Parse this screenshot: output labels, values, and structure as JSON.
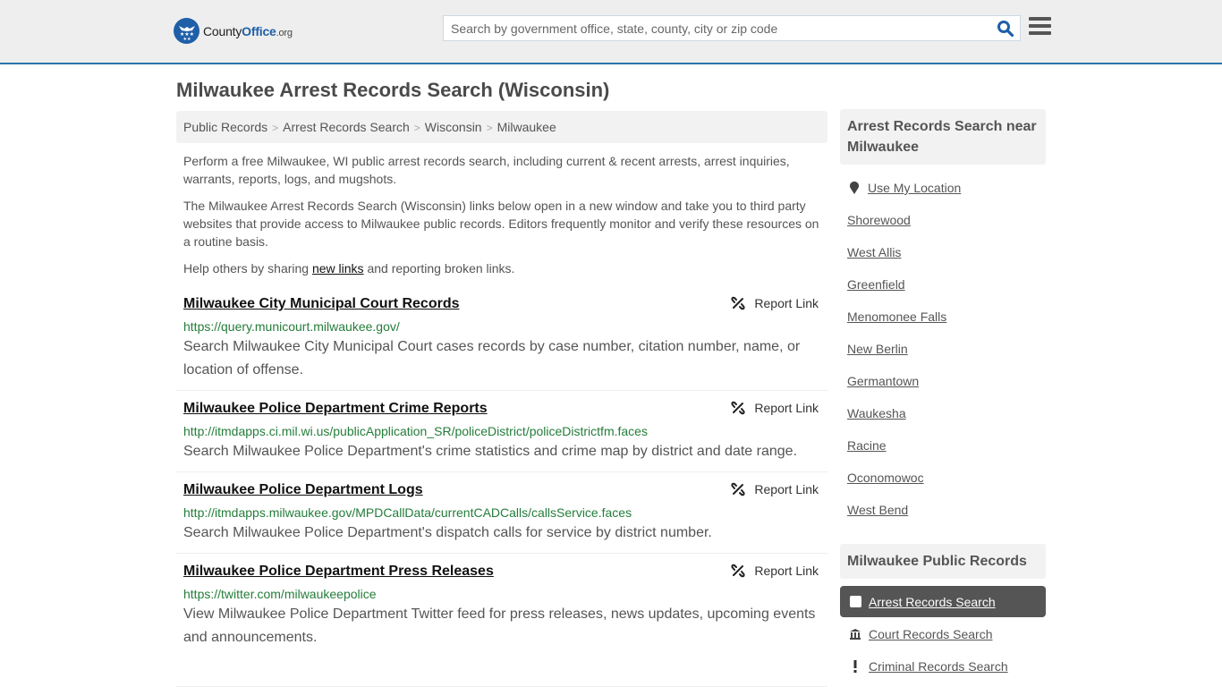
{
  "header": {
    "logo": {
      "name_part1": "County",
      "name_part2": "Office",
      "name_suffix": ".org"
    },
    "search": {
      "placeholder": "Search by government office, state, county, city or zip code",
      "value": ""
    },
    "colors": {
      "brand": "#1e5fa8",
      "header_bg": "#eeeeee",
      "accent_line": "#2b75ad"
    }
  },
  "page": {
    "title": "Milwaukee Arrest Records Search (Wisconsin)",
    "breadcrumb": [
      "Public Records",
      "Arrest Records Search",
      "Wisconsin",
      "Milwaukee"
    ],
    "breadcrumb_separator": ">",
    "intro": {
      "p1": "Perform a free Milwaukee, WI public arrest records search, including current & recent arrests, arrest inquiries, warrants, reports, logs, and mugshots.",
      "p2": "The Milwaukee Arrest Records Search (Wisconsin) links below open in a new window and take you to third party websites that provide access to Milwaukee public records. Editors frequently monitor and verify these resources on a routine basis.",
      "p3_before": "Help others by sharing ",
      "p3_link": "new links",
      "p3_after": " and reporting broken links."
    },
    "report_label": "Report Link",
    "listings": [
      {
        "title": "Milwaukee City Municipal Court Records",
        "url": "https://query.municourt.milwaukee.gov/",
        "description": "Search Milwaukee City Municipal Court cases records by case number, citation number, name, or location of offense."
      },
      {
        "title": "Milwaukee Police Department Crime Reports",
        "url": "http://itmdapps.ci.mil.wi.us/publicApplication_SR/policeDistrict/policeDistrictfm.faces",
        "description": "Search Milwaukee Police Department's crime statistics and crime map by district and date range."
      },
      {
        "title": "Milwaukee Police Department Logs",
        "url": "http://itmdapps.milwaukee.gov/MPDCallData/currentCADCalls/callsService.faces",
        "description": "Search Milwaukee Police Department's dispatch calls for service by district number."
      },
      {
        "title": "Milwaukee Police Department Press Releases",
        "url": "https://twitter.com/milwaukeepolice",
        "description": "View Milwaukee Police Department Twitter feed for press releases, news updates, upcoming events and announcements."
      }
    ]
  },
  "sidebar": {
    "nearby_heading": "Arrest Records Search near Milwaukee",
    "use_location": "Use My Location",
    "nearby": [
      "Shorewood",
      "West Allis",
      "Greenfield",
      "Menomonee Falls",
      "New Berlin",
      "Germantown",
      "Waukesha",
      "Racine",
      "Oconomowoc",
      "West Bend"
    ],
    "public_records_heading": "Milwaukee Public Records",
    "public_records": [
      {
        "label": "Arrest Records Search",
        "icon": "square-icon",
        "active": true
      },
      {
        "label": "Court Records Search",
        "icon": "courthouse-icon",
        "active": false
      },
      {
        "label": "Criminal Records Search",
        "icon": "exclamation-icon",
        "active": false
      }
    ]
  }
}
